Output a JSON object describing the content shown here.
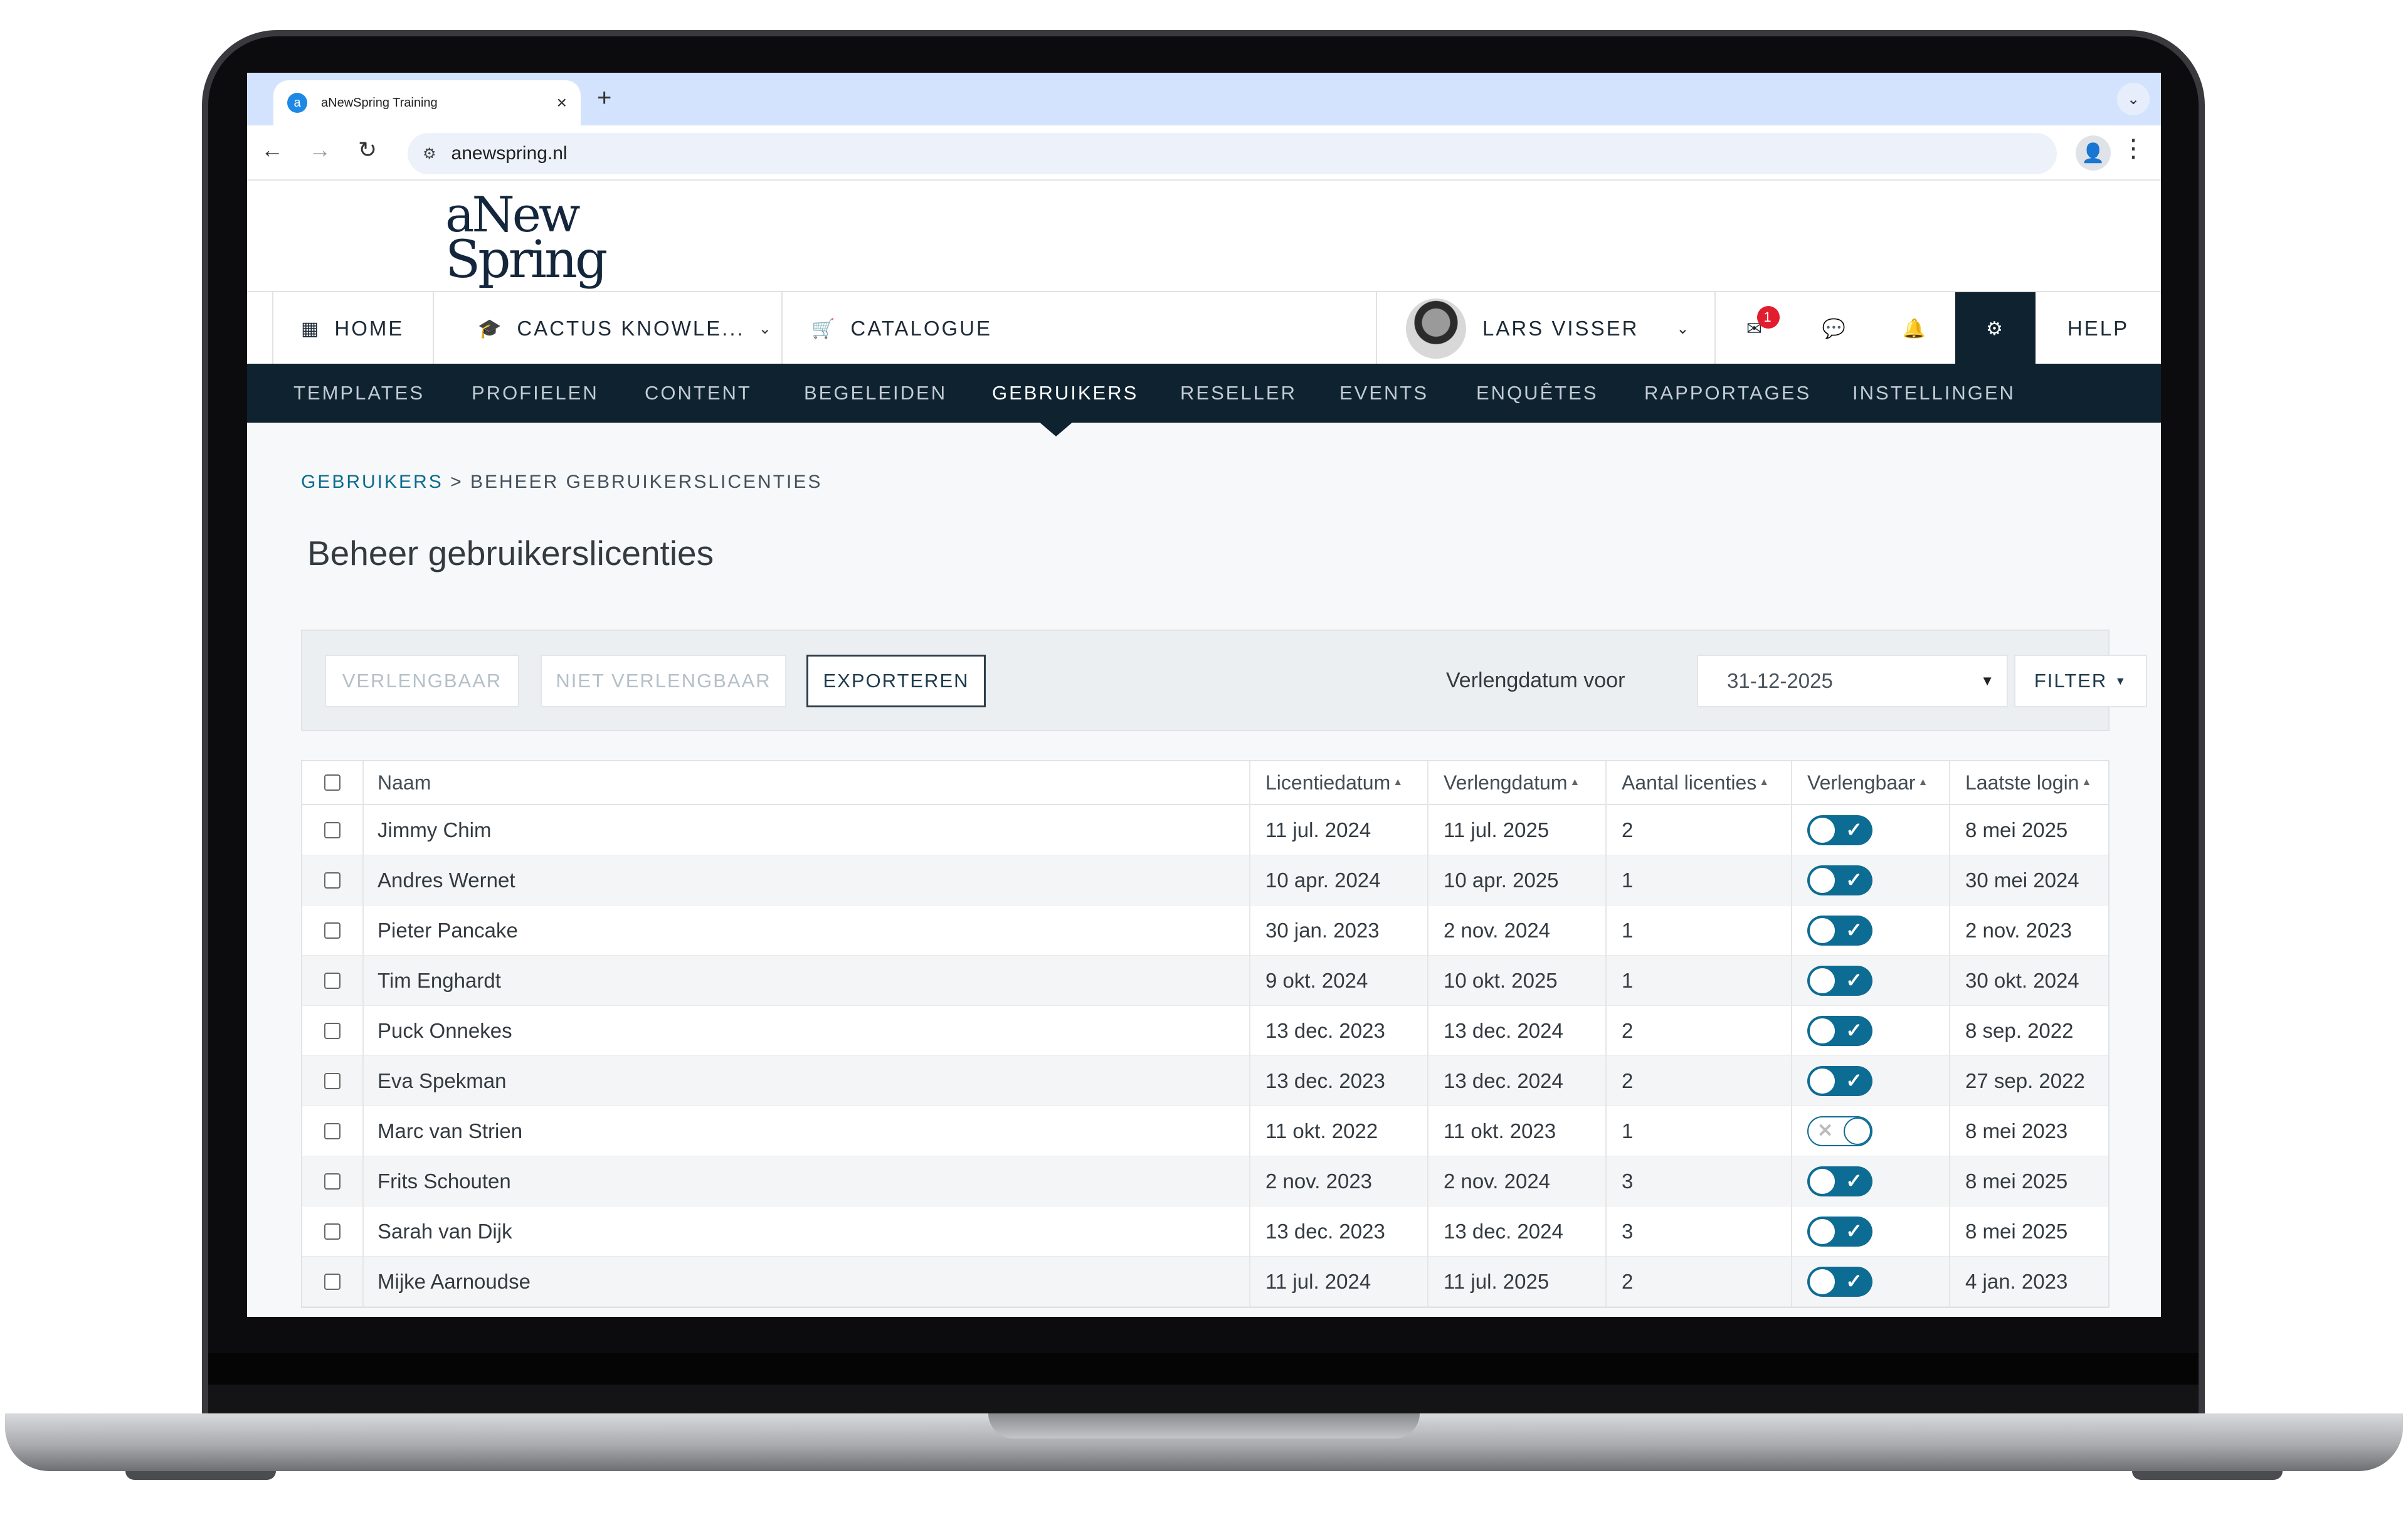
{
  "browser": {
    "tab_title": "aNewSpring Training",
    "new_tab": "+",
    "close": "×",
    "url": "anewspring.nl"
  },
  "logo": {
    "line1": "aNew",
    "line2": "Spring"
  },
  "mainnav": {
    "home": "HOME",
    "course": "CACTUS KNOWLE...",
    "catalogue": "CATALOGUE",
    "user": "LARS VISSER",
    "messages_badge": "1",
    "help": "HELP"
  },
  "subnav": [
    "TEMPLATES",
    "PROFIELEN",
    "CONTENT",
    "BEGELEIDEN",
    "GEBRUIKERS",
    "RESELLER",
    "EVENTS",
    "ENQUÊTES",
    "RAPPORTAGES",
    "INSTELLINGEN"
  ],
  "subnav_active": "GEBRUIKERS",
  "breadcrumb": {
    "parent": "GEBRUIKERS",
    "sep": ">",
    "current": "BEHEER GEBRUIKERSLICENTIES"
  },
  "page_title": "Beheer gebruikerslicenties",
  "toolbar": {
    "verlengbaar": "VERLENGBAAR",
    "niet_verlengbaar": "NIET VERLENGBAAR",
    "exporteren": "EXPORTEREN",
    "date_label": "Verlengdatum voor",
    "date_value": "31-12-2025",
    "filter": "FILTER"
  },
  "table": {
    "headers": [
      "Naam",
      "Licentiedatum",
      "Verlengdatum",
      "Aantal licenties",
      "Verlengbaar",
      "Laatste login"
    ],
    "rows": [
      {
        "naam": "Jimmy Chim",
        "licentie": "11 jul. 2024",
        "verleng": "11 jul. 2025",
        "aantal": "2",
        "verlengbaar": true,
        "login": "8 mei 2025"
      },
      {
        "naam": "Andres Wernet",
        "licentie": "10 apr. 2024",
        "verleng": "10 apr. 2025",
        "aantal": "1",
        "verlengbaar": true,
        "login": "30 mei 2024"
      },
      {
        "naam": "Pieter Pancake",
        "licentie": "30 jan. 2023",
        "verleng": "2 nov. 2024",
        "aantal": "1",
        "verlengbaar": true,
        "login": "2 nov. 2023"
      },
      {
        "naam": "Tim Enghardt",
        "licentie": "9 okt. 2024",
        "verleng": "10 okt. 2025",
        "aantal": "1",
        "verlengbaar": true,
        "login": "30 okt. 2024"
      },
      {
        "naam": "Puck Onnekes",
        "licentie": "13 dec. 2023",
        "verleng": "13 dec. 2024",
        "aantal": "2",
        "verlengbaar": true,
        "login": "8 sep. 2022"
      },
      {
        "naam": "Eva Spekman",
        "licentie": "13 dec. 2023",
        "verleng": "13 dec. 2024",
        "aantal": "2",
        "verlengbaar": true,
        "login": "27 sep. 2022"
      },
      {
        "naam": "Marc van Strien",
        "licentie": "11 okt. 2022",
        "verleng": "11 okt. 2023",
        "aantal": "1",
        "verlengbaar": false,
        "login": "8 mei 2023"
      },
      {
        "naam": "Frits Schouten",
        "licentie": "2 nov. 2023",
        "verleng": "2 nov. 2024",
        "aantal": "3",
        "verlengbaar": true,
        "login": "8 mei 2025"
      },
      {
        "naam": "Sarah van Dijk",
        "licentie": "13 dec. 2023",
        "verleng": "13 dec. 2024",
        "aantal": "3",
        "verlengbaar": true,
        "login": "8 mei 2025"
      },
      {
        "naam": "Mijke Aarnoudse",
        "licentie": "11 jul. 2024",
        "verleng": "11 jul. 2025",
        "aantal": "2",
        "verlengbaar": true,
        "login": "4 jan. 2023"
      }
    ]
  },
  "colors": {
    "nav_dark": "#0f2230",
    "accent": "#0d6c93",
    "badge": "#e11d2e"
  }
}
